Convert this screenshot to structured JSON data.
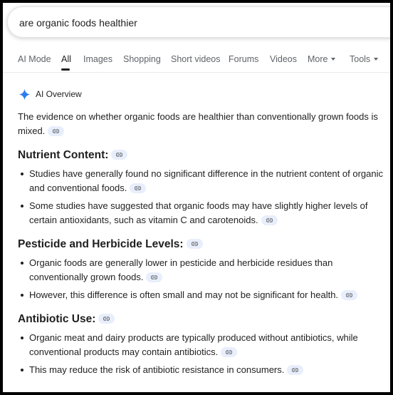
{
  "search": {
    "query": "are organic foods healthier"
  },
  "tabs": [
    {
      "label": "AI Mode"
    },
    {
      "label": "All"
    },
    {
      "label": "Images"
    },
    {
      "label": "Shopping"
    },
    {
      "label": "Short videos"
    },
    {
      "label": "Forums"
    },
    {
      "label": "Videos"
    },
    {
      "label": "More"
    },
    {
      "label": "Tools"
    }
  ],
  "active_tab": "All",
  "ai_overview": {
    "title": "AI Overview",
    "intro": "The evidence on whether organic foods are healthier than conventionally grown foods is mixed.",
    "sections": [
      {
        "heading": "Nutrient Content:",
        "bullets": [
          "Studies have generally found no significant difference in the nutrient content of organic and conventional foods.",
          "Some studies have suggested that organic foods may have slightly higher levels of certain antioxidants, such as vitamin C and carotenoids."
        ]
      },
      {
        "heading": "Pesticide and Herbicide Levels:",
        "bullets": [
          "Organic foods are generally lower in pesticide and herbicide residues than conventionally grown foods.",
          "However, this difference is often small and may not be significant for health."
        ]
      },
      {
        "heading": "Antibiotic Use:",
        "bullets": [
          "Organic meat and dairy products are typically produced without antibiotics, while conventional products may contain antibiotics.",
          "This may reduce the risk of antibiotic resistance in consumers."
        ]
      }
    ]
  },
  "icons": {
    "sparkle": "gemini-sparkle-icon",
    "link": "link-icon"
  },
  "colors": {
    "sparkle": "#4285f4",
    "link_chip_bg": "#e8eefb",
    "link_icon": "#5f6368"
  }
}
